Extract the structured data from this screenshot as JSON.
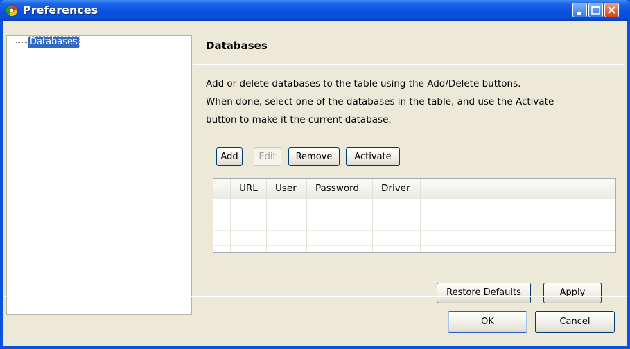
{
  "window": {
    "title": "Preferences",
    "app_icon": "app-icon",
    "controls": [
      "minimize-icon",
      "maximize-icon",
      "close-icon"
    ],
    "colors": {
      "titlebar": "#0a52e0",
      "client_bg": "#ece9d8",
      "selection": "#316ac5"
    }
  },
  "tree": {
    "items": [
      {
        "label": "Databases",
        "selected": true
      }
    ]
  },
  "page": {
    "title": "Databases",
    "description": [
      "Add or delete databases to the table using the Add/Delete buttons.",
      "When done, select one of the databases in the table, and use the Activate",
      "button to make it the current database."
    ]
  },
  "toolbar": {
    "add_label": "Add",
    "edit_label": "Edit",
    "remove_label": "Remove",
    "activate_label": "Activate"
  },
  "table": {
    "columns": [
      "",
      "URL",
      "User",
      "Password",
      "Driver"
    ],
    "rows": []
  },
  "page_buttons": {
    "restore_defaults_label": "Restore Defaults",
    "apply_label": "Apply"
  },
  "dialog_buttons": {
    "ok_label": "OK",
    "cancel_label": "Cancel"
  }
}
